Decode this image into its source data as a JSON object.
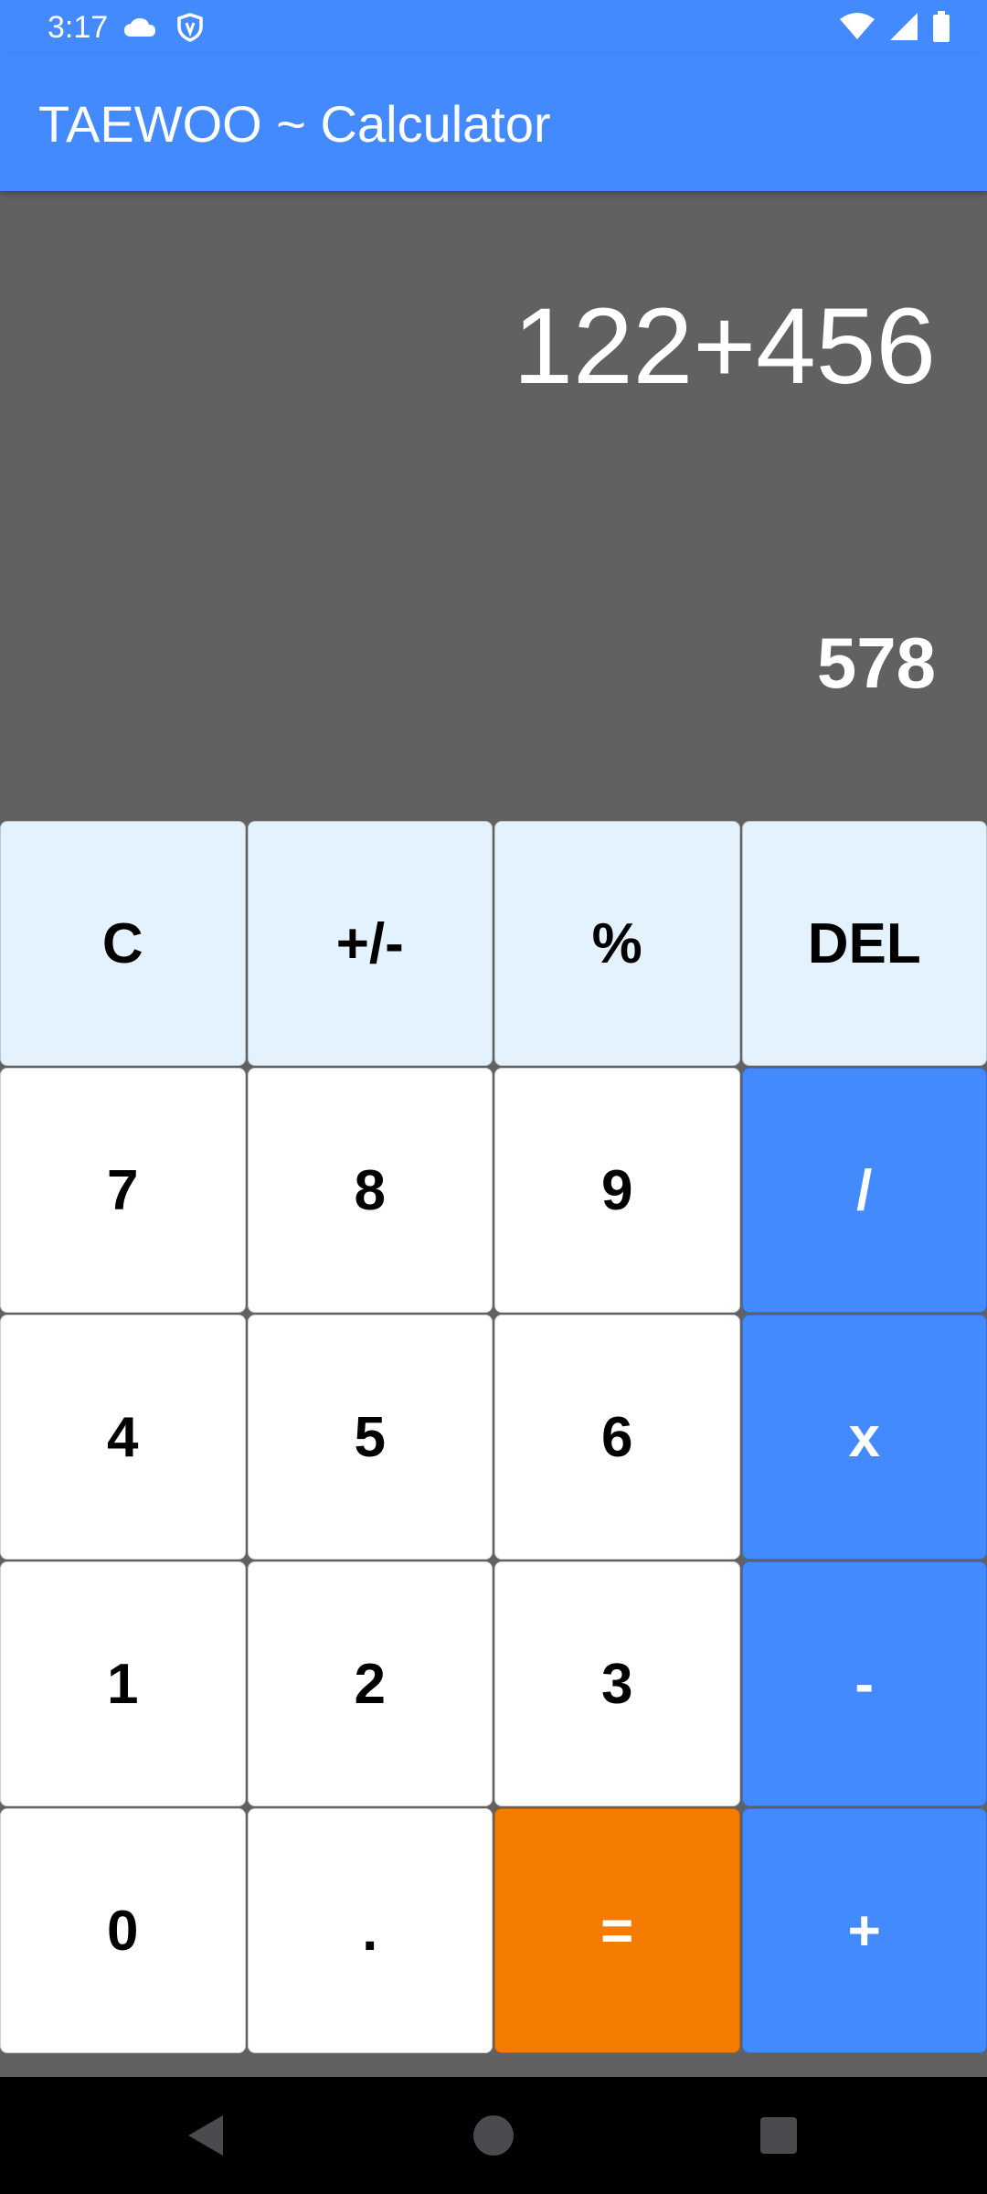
{
  "status_bar": {
    "time": "3:17",
    "left_icons": [
      "cloud-icon",
      "shield-icon"
    ],
    "right_icons": [
      "wifi-icon",
      "signal-icon",
      "battery-icon"
    ]
  },
  "app_bar": {
    "title": "TAEWOO ~ Calculator"
  },
  "display": {
    "expression": "122+456",
    "result": "578"
  },
  "keypad": {
    "rows": [
      [
        {
          "label": "C",
          "type": "fn"
        },
        {
          "label": "+/-",
          "type": "fn"
        },
        {
          "label": "%",
          "type": "fn"
        },
        {
          "label": "DEL",
          "type": "fn"
        }
      ],
      [
        {
          "label": "7",
          "type": "num"
        },
        {
          "label": "8",
          "type": "num"
        },
        {
          "label": "9",
          "type": "num"
        },
        {
          "label": "/",
          "type": "op"
        }
      ],
      [
        {
          "label": "4",
          "type": "num"
        },
        {
          "label": "5",
          "type": "num"
        },
        {
          "label": "6",
          "type": "num"
        },
        {
          "label": "x",
          "type": "op"
        }
      ],
      [
        {
          "label": "1",
          "type": "num"
        },
        {
          "label": "2",
          "type": "num"
        },
        {
          "label": "3",
          "type": "num"
        },
        {
          "label": "-",
          "type": "op"
        }
      ],
      [
        {
          "label": "0",
          "type": "num"
        },
        {
          "label": ".",
          "type": "num"
        },
        {
          "label": "=",
          "type": "eq"
        },
        {
          "label": "+",
          "type": "op"
        }
      ]
    ]
  },
  "nav_bar": {
    "buttons": [
      "back-icon",
      "home-icon",
      "recents-icon"
    ]
  },
  "colors": {
    "primary": "#448aff",
    "display_background": "#616161",
    "function_key": "#e3f2fd",
    "number_key": "#ffffff",
    "equals_key": "#f57c00"
  }
}
